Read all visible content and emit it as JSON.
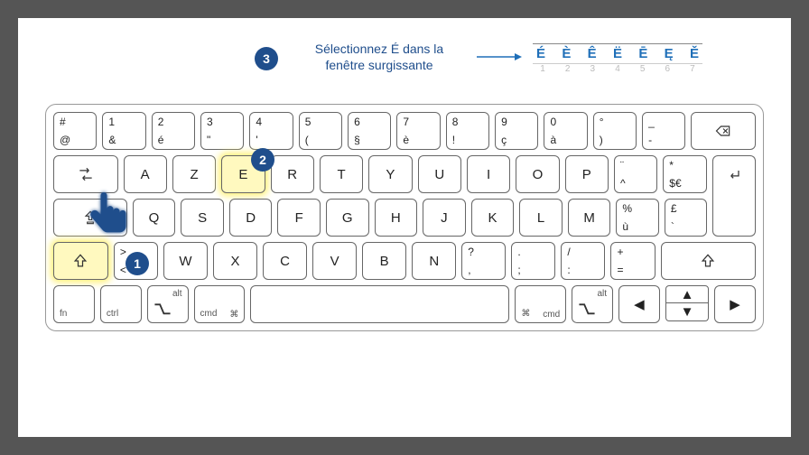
{
  "instruction": {
    "badge3": "3",
    "text": "Sélectionnez É dans la fenêtre surgissante"
  },
  "popup": {
    "letters": [
      "É",
      "È",
      "Ê",
      "Ë",
      "Ē",
      "Ę",
      "Ě"
    ],
    "numbers": [
      "1",
      "2",
      "3",
      "4",
      "5",
      "6",
      "7"
    ]
  },
  "badges": {
    "b1": "1",
    "b2": "2"
  },
  "rows": {
    "r1": [
      {
        "top": "#",
        "bot": "@"
      },
      {
        "top": "1",
        "bot": "&"
      },
      {
        "top": "2",
        "bot": "é"
      },
      {
        "top": "3",
        "bot": "\""
      },
      {
        "top": "4",
        "bot": "'"
      },
      {
        "top": "5",
        "bot": "("
      },
      {
        "top": "6",
        "bot": "§"
      },
      {
        "top": "7",
        "bot": "è"
      },
      {
        "top": "8",
        "bot": "!"
      },
      {
        "top": "9",
        "bot": "ç"
      },
      {
        "top": "0",
        "bot": "à"
      },
      {
        "top": "°",
        "bot": ")"
      },
      {
        "top": "_",
        "bot": "-"
      }
    ],
    "r2_letters": [
      "A",
      "Z",
      "E",
      "R",
      "T",
      "Y",
      "U",
      "I",
      "O",
      "P"
    ],
    "r2_end": [
      {
        "top": "¨",
        "bot": "^"
      },
      {
        "top": "*",
        "bot": "$€"
      }
    ],
    "r3_letters": [
      "Q",
      "S",
      "D",
      "F",
      "G",
      "H",
      "J",
      "K",
      "L",
      "M"
    ],
    "r3_end": [
      {
        "top": "%",
        "bot": "ù"
      },
      {
        "top": "£",
        "bot": "`"
      }
    ],
    "r4_first": {
      "top": ">",
      "bot": "<"
    },
    "r4_letters": [
      "W",
      "X",
      "C",
      "V",
      "B",
      "N"
    ],
    "r4_end": [
      {
        "top": "?",
        "bot": ","
      },
      {
        "top": ".",
        "bot": ";"
      },
      {
        "top": "/",
        "bot": ":"
      },
      {
        "top": "+",
        "bot": "="
      }
    ],
    "r5": {
      "fn": "fn",
      "ctrl": "ctrl",
      "alt": "alt",
      "cmd": "cmd"
    }
  }
}
